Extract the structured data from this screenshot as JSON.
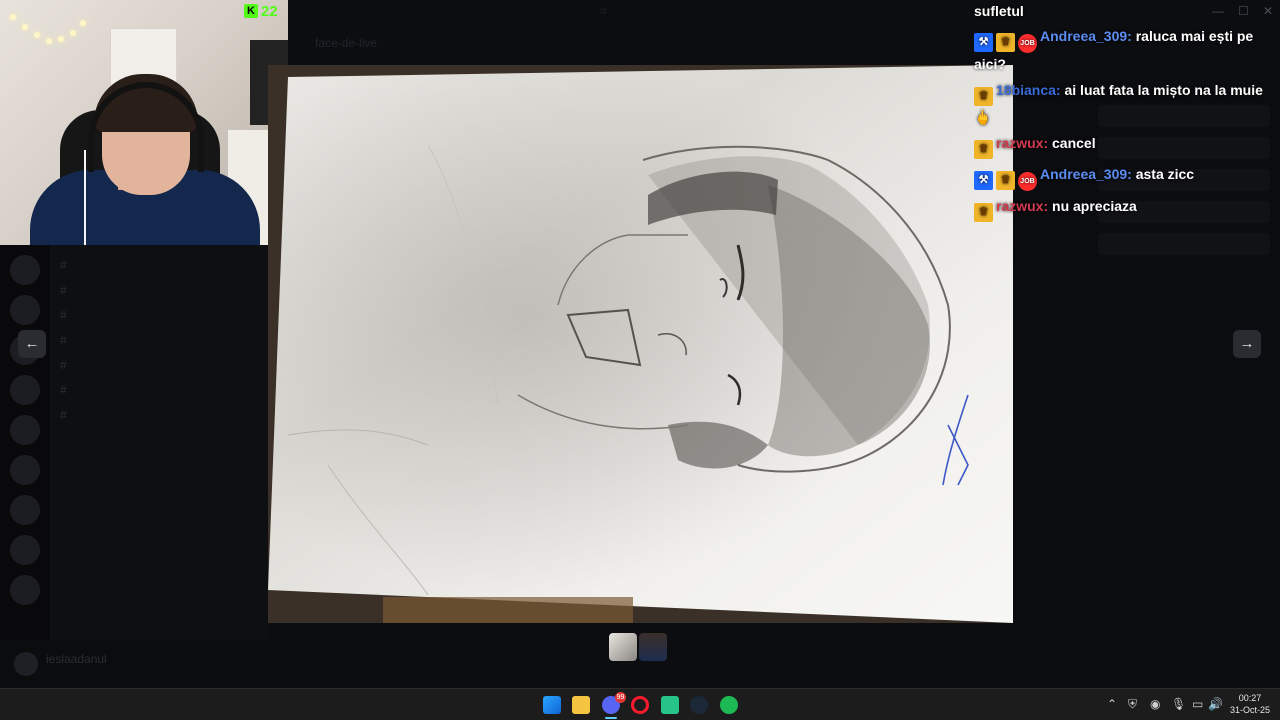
{
  "stream_overlay": {
    "platform_icon": "kick-icon",
    "viewer_count": "22",
    "accent": "#53fc18"
  },
  "chat": {
    "top_fragment": "sufletul",
    "messages": [
      {
        "user": "Andreea_309:",
        "badges": [
          "mod",
          "vip",
          "job"
        ],
        "text": "raluca mai ești pe aici?",
        "user_color": "#5b8df2"
      },
      {
        "user": "18bianca:",
        "badges": [
          "vip"
        ],
        "text": "ai luat fata la mișto na la muie 🖕",
        "user_color": "#3a6bd8"
      },
      {
        "user": "razwux:",
        "badges": [
          "vip"
        ],
        "text": "cancel",
        "user_color": "#d33a4f"
      },
      {
        "user": "Andreea_309:",
        "badges": [
          "mod",
          "vip",
          "job"
        ],
        "text": "asta zicc",
        "user_color": "#5b8df2"
      },
      {
        "user": "razwux:",
        "badges": [
          "vip"
        ],
        "text": "nu apreciaza",
        "user_color": "#d33a4f"
      }
    ],
    "badge_labels": {
      "job": "JOB"
    }
  },
  "viewer": {
    "prev_icon": "arrow-left-icon",
    "next_icon": "arrow-right-icon",
    "prev_glyph": "←",
    "next_glyph": "→",
    "image_subject": "pencil-portrait-drawing",
    "thumbnails": [
      "drawing-thumbnail",
      "webcam-thumbnail"
    ]
  },
  "discord_background": {
    "channel": "face-de-live",
    "user": "ieslaadanul"
  },
  "taskbar": {
    "apps": [
      "windows-start-icon",
      "file-explorer-icon",
      "discord-icon",
      "opera-gx-icon",
      "app-icon",
      "steam-icon",
      "spotify-icon"
    ],
    "discord_badge": "99",
    "time": "00:27",
    "date": "31-Oct-25"
  }
}
